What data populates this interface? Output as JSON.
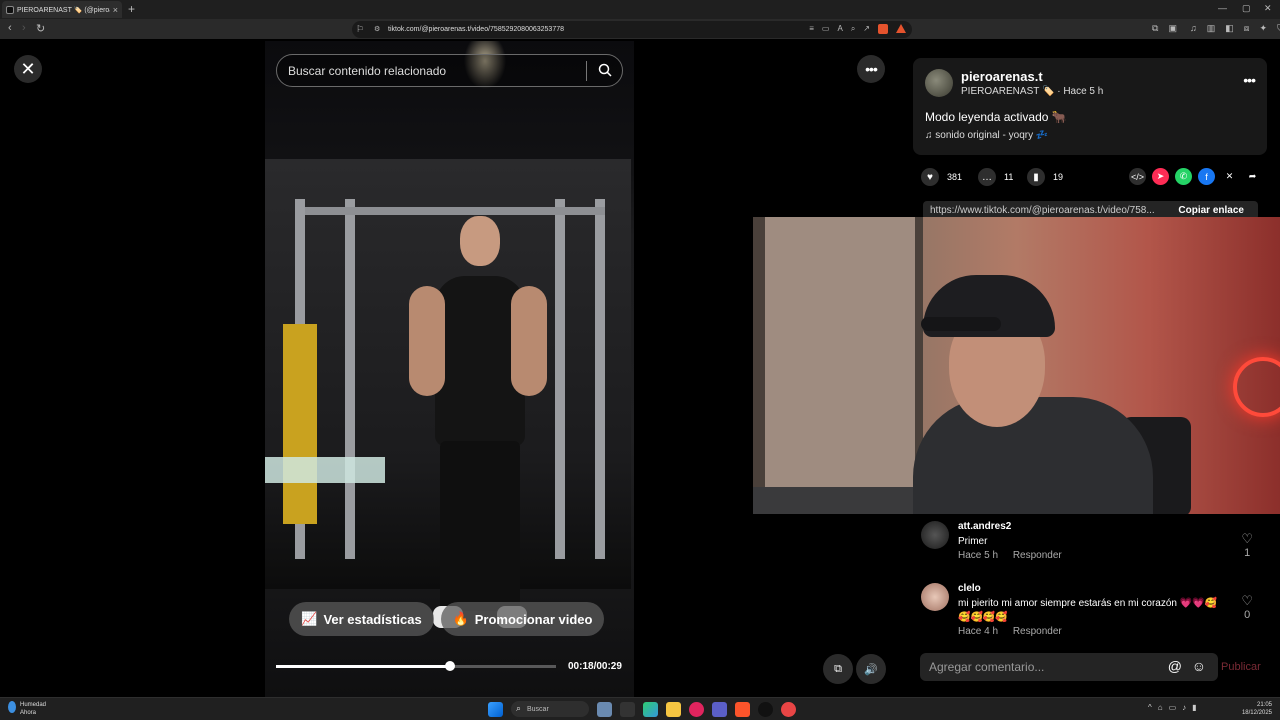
{
  "browser": {
    "tab_title": "PIEROARENAST 🏷️ (@pieroa...",
    "url": "tiktok.com/@pieroarenas.t/video/7585292080063253778",
    "new_tab": "+",
    "tab_close": "×"
  },
  "video": {
    "search_placeholder": "Buscar contenido relacionado",
    "stats_button": "Ver estadísticas",
    "promote_button": "Promocionar video",
    "time": "00:18/00:29",
    "progress": 0.62
  },
  "post": {
    "username": "pieroarenas.t",
    "nickname": "PIEROARENAST 🏷️",
    "separator": "·",
    "posted": "Hace 5 h",
    "description": "Modo leyenda activado 🐂",
    "sound": "sonido original - yoqry 💤",
    "likes": "381",
    "comments": "11",
    "saves": "19",
    "link": "https://www.tiktok.com/@pieroarenas.t/video/758...",
    "copy_link": "Copiar enlace"
  },
  "comments": [
    {
      "user": "att.andres2",
      "text": "Primer",
      "time": "Hace 5 h",
      "reply": "Responder",
      "likes": "1"
    },
    {
      "user": "clelo",
      "text": "mi pierito mi amor siempre estarás en mi corazón 💗💗🥰 🥰🥰🥰🥰",
      "time": "Hace 4 h",
      "reply": "Responder",
      "likes": "0"
    }
  ],
  "composer": {
    "placeholder": "Agregar comentario...",
    "post_button": "Publicar"
  },
  "taskbar": {
    "weather_label": "Humedad",
    "weather_sub": "Ahora",
    "search": "Buscar",
    "time": "21:05",
    "date": "18/12/2025"
  },
  "colors": {
    "background": "#000000",
    "card": "#181818",
    "accent_red": "#fe2c55"
  }
}
